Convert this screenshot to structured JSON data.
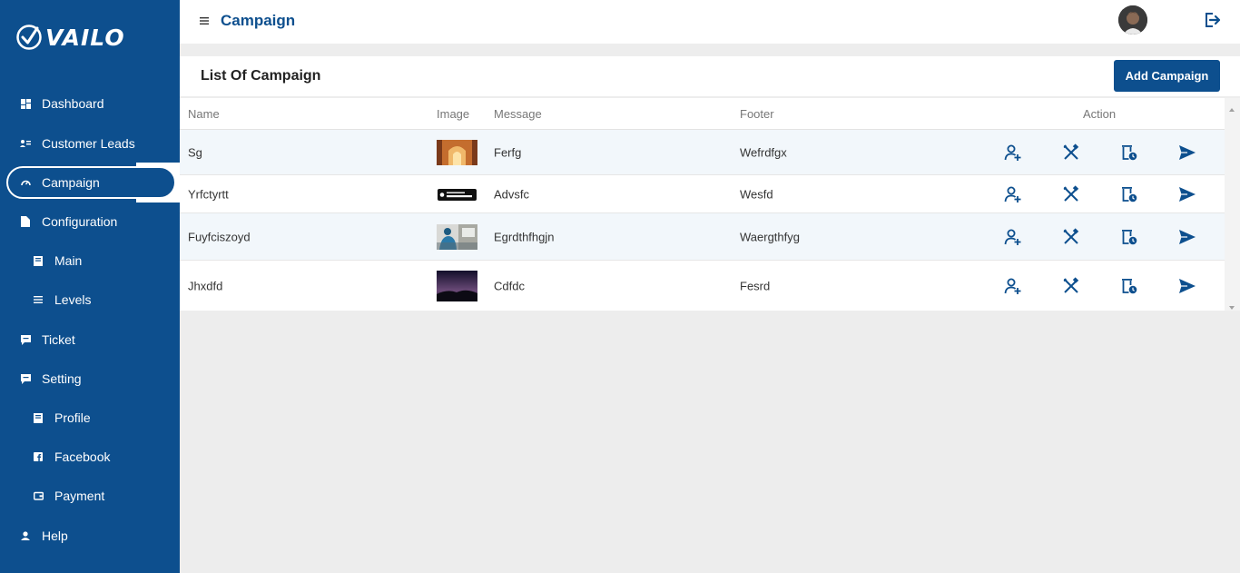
{
  "brand": {
    "name": "VAILO"
  },
  "colors": {
    "primary": "#0d4f8e",
    "background": "#ededed",
    "row_alt": "#f2f7fb"
  },
  "sidebar": {
    "items": [
      {
        "label": "Dashboard",
        "icon": "grid-icon"
      },
      {
        "label": "Customer Leads",
        "icon": "contacts-icon"
      },
      {
        "label": "Campaign",
        "icon": "gauge-icon",
        "active": true
      },
      {
        "label": "Configuration",
        "icon": "document-icon"
      },
      {
        "label": "Main",
        "icon": "book-icon"
      },
      {
        "label": "Levels",
        "icon": "list-icon"
      },
      {
        "label": "Ticket",
        "icon": "chat-icon"
      },
      {
        "label": "Setting",
        "icon": "chat-icon"
      },
      {
        "label": "Profile",
        "icon": "book-icon"
      },
      {
        "label": "Facebook",
        "icon": "facebook-icon"
      },
      {
        "label": "Payment",
        "icon": "wallet-icon"
      },
      {
        "label": "Help",
        "icon": "user-icon"
      }
    ]
  },
  "header": {
    "title": "Campaign"
  },
  "card": {
    "title": "List Of Campaign",
    "add_button": "Add Campaign"
  },
  "table": {
    "columns": [
      "Name",
      "Image",
      "Message",
      "Footer",
      "Action"
    ],
    "rows": [
      {
        "name": "Sg",
        "message": "Ferfg",
        "footer": "Wefrdfgx",
        "image": "arch-corridor-photo"
      },
      {
        "name": "Yrfctyrtt",
        "message": "Advsfc",
        "footer": "Wesfd",
        "image": "app-store-badge"
      },
      {
        "name": "Fuyfciszoyd",
        "message": "Egrdthfhgjn",
        "footer": "Waergthfyg",
        "image": "person-photo"
      },
      {
        "name": "Jhxdfd",
        "message": "Cdfdc",
        "footer": "Fesrd",
        "image": "night-sky-photo"
      }
    ],
    "actions": [
      "add-user-icon",
      "tools-icon",
      "delete-schedule-icon",
      "send-icon"
    ]
  }
}
